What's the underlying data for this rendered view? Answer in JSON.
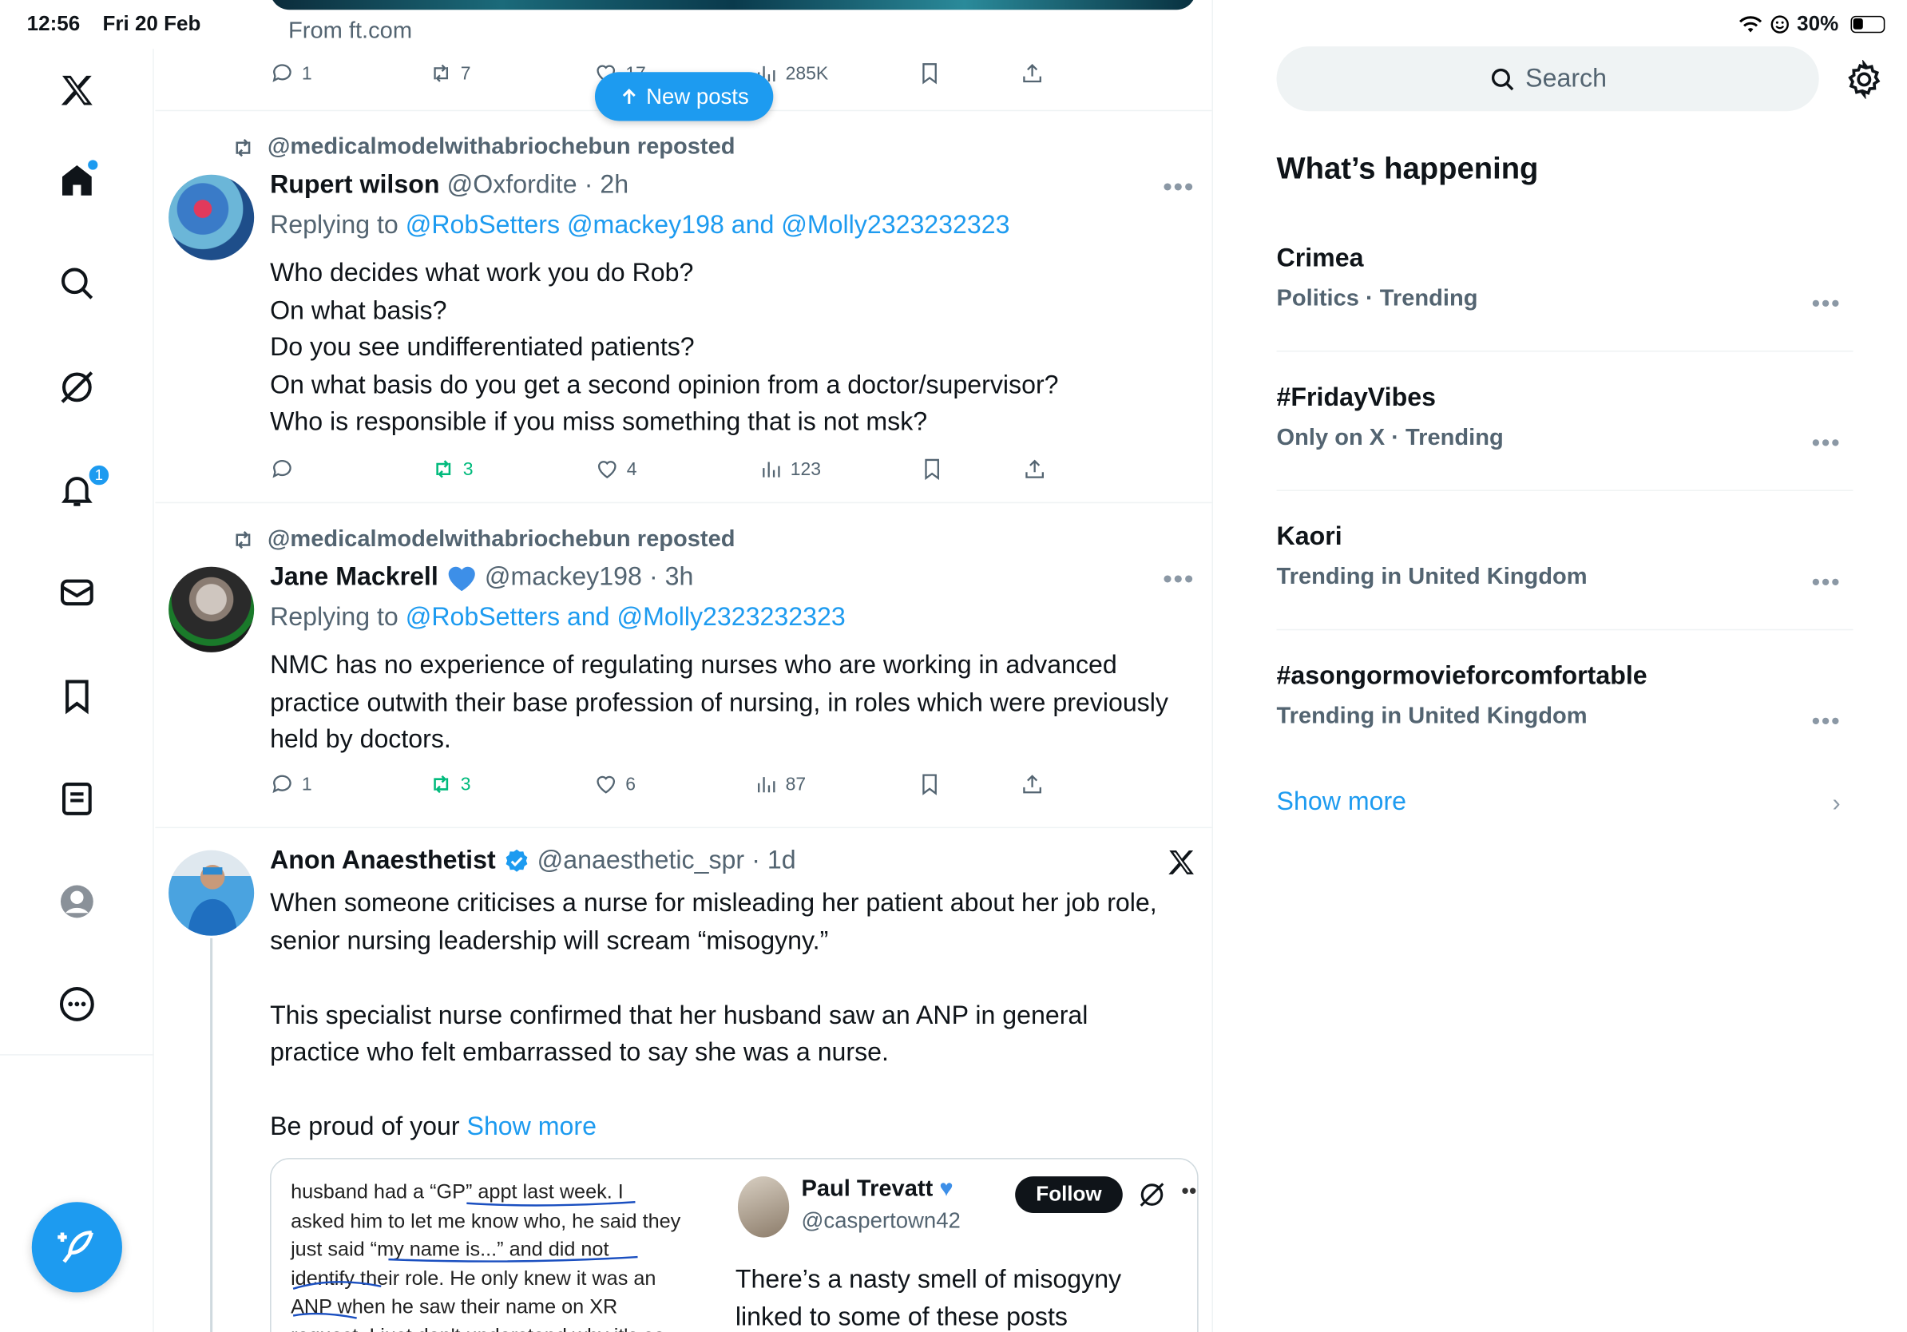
{
  "status_bar": {
    "time": "12:56",
    "date": "Fri 20 Feb",
    "battery": "30%"
  },
  "nav": {
    "items": [
      {
        "name": "x-logo"
      },
      {
        "name": "home"
      },
      {
        "name": "explore"
      },
      {
        "name": "grok"
      },
      {
        "name": "notifications",
        "badge": "1"
      },
      {
        "name": "messages"
      },
      {
        "name": "bookmarks"
      },
      {
        "name": "lists"
      },
      {
        "name": "profile"
      },
      {
        "name": "more"
      }
    ]
  },
  "timeline": {
    "prev_post": {
      "source": "From ft.com",
      "replies": "1",
      "reposts": "7",
      "likes": "17",
      "views": "285K"
    },
    "new_posts_label": "New posts",
    "post1": {
      "repost_by": "@medicalmodelwithabriochebun reposted",
      "name": "Rupert wilson",
      "handle": "@Oxfordite",
      "time": "· 2h",
      "replying_prefix": "Replying to",
      "replying_to": "@RobSetters @mackey198 and @Molly2323232323",
      "text": "Who decides what work you do Rob?\nOn what basis?\nDo you see undifferentiated patients?\nOn what basis do you get a second opinion from a doctor/supervisor?\nWho is responsible if you miss something that is not msk?",
      "replies": "",
      "reposts": "3",
      "likes": "4",
      "views": "123"
    },
    "post2": {
      "repost_by": "@medicalmodelwithabriochebun reposted",
      "name": "Jane Mackrell",
      "handle": "@mackey198",
      "time": "· 3h",
      "replying_prefix": "Replying to",
      "replying_to": "@RobSetters and @Molly2323232323",
      "text": "NMC has no experience of regulating nurses who are working in advanced practice outwith their base profession of nursing, in roles which were previously held by doctors.",
      "replies": "1",
      "reposts": "3",
      "likes": "6",
      "views": "87"
    },
    "post3": {
      "name": "Anon Anaesthetist",
      "handle": "@anaesthetic_spr",
      "time": "· 1d",
      "text": "When someone criticises a nurse for misleading her patient about her job role, senior nursing leadership will scream “misogyny.”\n\nThis specialist nurse confirmed that her husband saw an ANP in general practice who felt embarrassed to say she was a nurse.\n\nBe proud of your",
      "show_more": "Show more",
      "quote": {
        "left_text": "husband had a “GP” appt last week. I\nasked him to let me know who, he said they\njust said  “my name is...” and did not\nidentify their role. He only knew it was an\nANP when he saw their name on XR\nrequest. I just don't understand why it's so",
        "name": "Paul Trevatt",
        "handle": "@caspertown42",
        "follow_label": "Follow",
        "text": "There’s a nasty smell of misogyny\nlinked to some of these posts"
      }
    }
  },
  "sidebar": {
    "search_placeholder": "Search",
    "section_title": "What’s happening",
    "trends": [
      {
        "name": "Crimea",
        "meta": "Politics · Trending"
      },
      {
        "name": "#FridayVibes",
        "meta": "Only on X · Trending"
      },
      {
        "name": "Kaori",
        "meta": "Trending in United Kingdom"
      },
      {
        "name": "#asongormovieforcomfortable",
        "meta": "Trending in United Kingdom"
      }
    ],
    "show_more": "Show more"
  },
  "colors": {
    "accent": "#1d9bf0",
    "repost_green": "#00ba7c",
    "muted": "#536471"
  }
}
